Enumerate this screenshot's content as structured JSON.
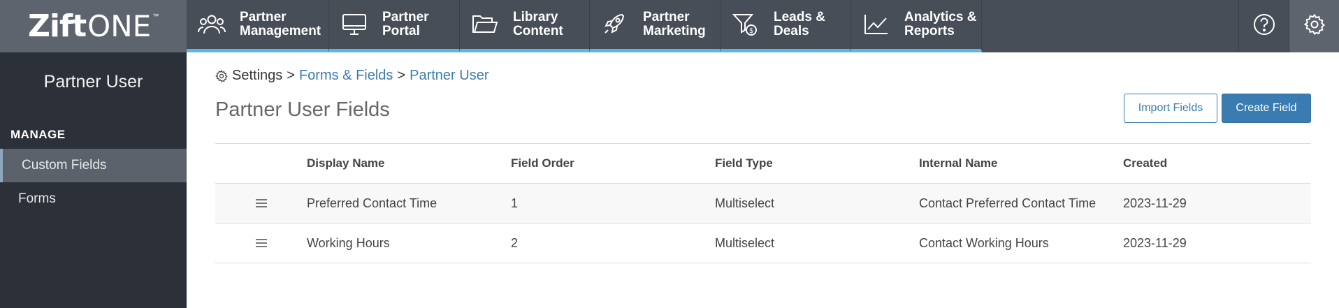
{
  "brand": {
    "logo_bold": "Zift",
    "logo_light": "ONE",
    "logo_tm": "™"
  },
  "nav": {
    "items": [
      {
        "label": "Partner\nManagement",
        "icon": "users-icon"
      },
      {
        "label": "Partner\nPortal",
        "icon": "monitor-icon"
      },
      {
        "label": "Library\nContent",
        "icon": "folder-icon"
      },
      {
        "label": "Partner\nMarketing",
        "icon": "rocket-icon"
      },
      {
        "label": "Leads &\nDeals",
        "icon": "funnel-dollar-icon"
      },
      {
        "label": "Analytics &\nReports",
        "icon": "line-chart-icon"
      }
    ],
    "accent": "#5bb6e4",
    "help_icon": "help-icon",
    "settings_icon": "gear-icon"
  },
  "sidebar": {
    "title": "Partner User",
    "section": "MANAGE",
    "items": [
      {
        "label": "Custom Fields",
        "active": true
      },
      {
        "label": "Forms",
        "active": false
      }
    ]
  },
  "breadcrumb": {
    "root": "Settings",
    "sep1": ">",
    "link1": "Forms & Fields",
    "sep2": ">",
    "link2": "Partner User"
  },
  "page": {
    "title": "Partner User Fields",
    "import_label": "Import Fields",
    "create_label": "Create Field"
  },
  "table": {
    "columns": [
      "Display Name",
      "Field Order",
      "Field Type",
      "Internal Name",
      "Created"
    ],
    "rows": [
      {
        "display_name": "Preferred Contact Time",
        "order": "1",
        "type": "Multiselect",
        "internal": "Contact Preferred Contact Time",
        "created": "2023-11-29"
      },
      {
        "display_name": "Working Hours",
        "order": "2",
        "type": "Multiselect",
        "internal": "Contact Working Hours",
        "created": "2023-11-29"
      }
    ]
  },
  "colors": {
    "link": "#3a7cb1",
    "topbar": "#474e58",
    "sidebar": "#2c3038"
  }
}
